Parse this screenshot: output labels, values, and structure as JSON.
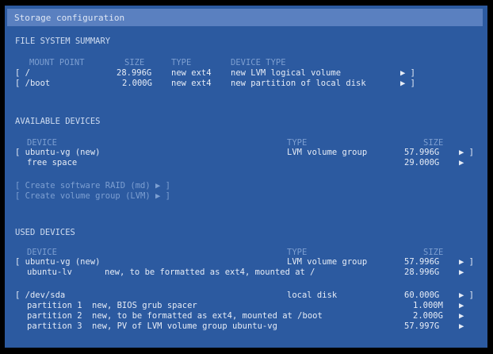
{
  "window": {
    "title": "Storage configuration"
  },
  "fs_summary": {
    "heading": "FILE SYSTEM SUMMARY",
    "columns": [
      "MOUNT POINT",
      "SIZE",
      "TYPE",
      "DEVICE TYPE"
    ],
    "rows": [
      {
        "mount": "[ /",
        "size": "28.996G",
        "type": "new ext4",
        "device_type": "new LVM logical volume",
        "action": "▶ ]"
      },
      {
        "mount": "[ /boot",
        "size": "2.000G",
        "type": "new ext4",
        "device_type": "new partition of local disk",
        "action": "▶ ]"
      }
    ]
  },
  "available": {
    "heading": "AVAILABLE DEVICES",
    "columns": [
      "DEVICE",
      "TYPE",
      "SIZE"
    ],
    "rows": [
      {
        "device": "[ ubuntu-vg (new)",
        "type": "LVM volume group",
        "size": "57.996G",
        "action": "▶ ]"
      },
      {
        "device": "free space",
        "type": "",
        "size": "29.000G",
        "action": "▶"
      }
    ],
    "actions": [
      "[ Create software RAID (md) ▶ ]",
      "[ Create volume group (LVM) ▶ ]"
    ]
  },
  "used": {
    "heading": "USED DEVICES",
    "columns": [
      "DEVICE",
      "TYPE",
      "SIZE"
    ],
    "vg": {
      "device": "[ ubuntu-vg (new)",
      "type": "LVM volume group",
      "size": "57.996G",
      "action": "▶ ]",
      "lv_name": "ubuntu-lv",
      "lv_desc": "new, to be formatted as ext4, mounted at /",
      "lv_size": "28.996G",
      "lv_action": "▶"
    },
    "disk": {
      "device": "[ /dev/sda",
      "type": "local disk",
      "size": "60.000G",
      "action": "▶ ]",
      "partitions": [
        {
          "name": "partition 1",
          "desc": "new, BIOS grub spacer",
          "size": "1.000M",
          "action": "▶"
        },
        {
          "name": "partition 2",
          "desc": "new, to be formatted as ext4, mounted at /boot",
          "size": "2.000G",
          "action": "▶"
        },
        {
          "name": "partition 3",
          "desc": "new, PV of LVM volume group ubuntu-vg",
          "size": "57.997G",
          "action": "▶"
        }
      ]
    }
  },
  "colors": {
    "background": "#2c5aa0",
    "titlebar": "#5a80c0",
    "text": "#e6ecf6",
    "dim": "#7d9fd1"
  }
}
